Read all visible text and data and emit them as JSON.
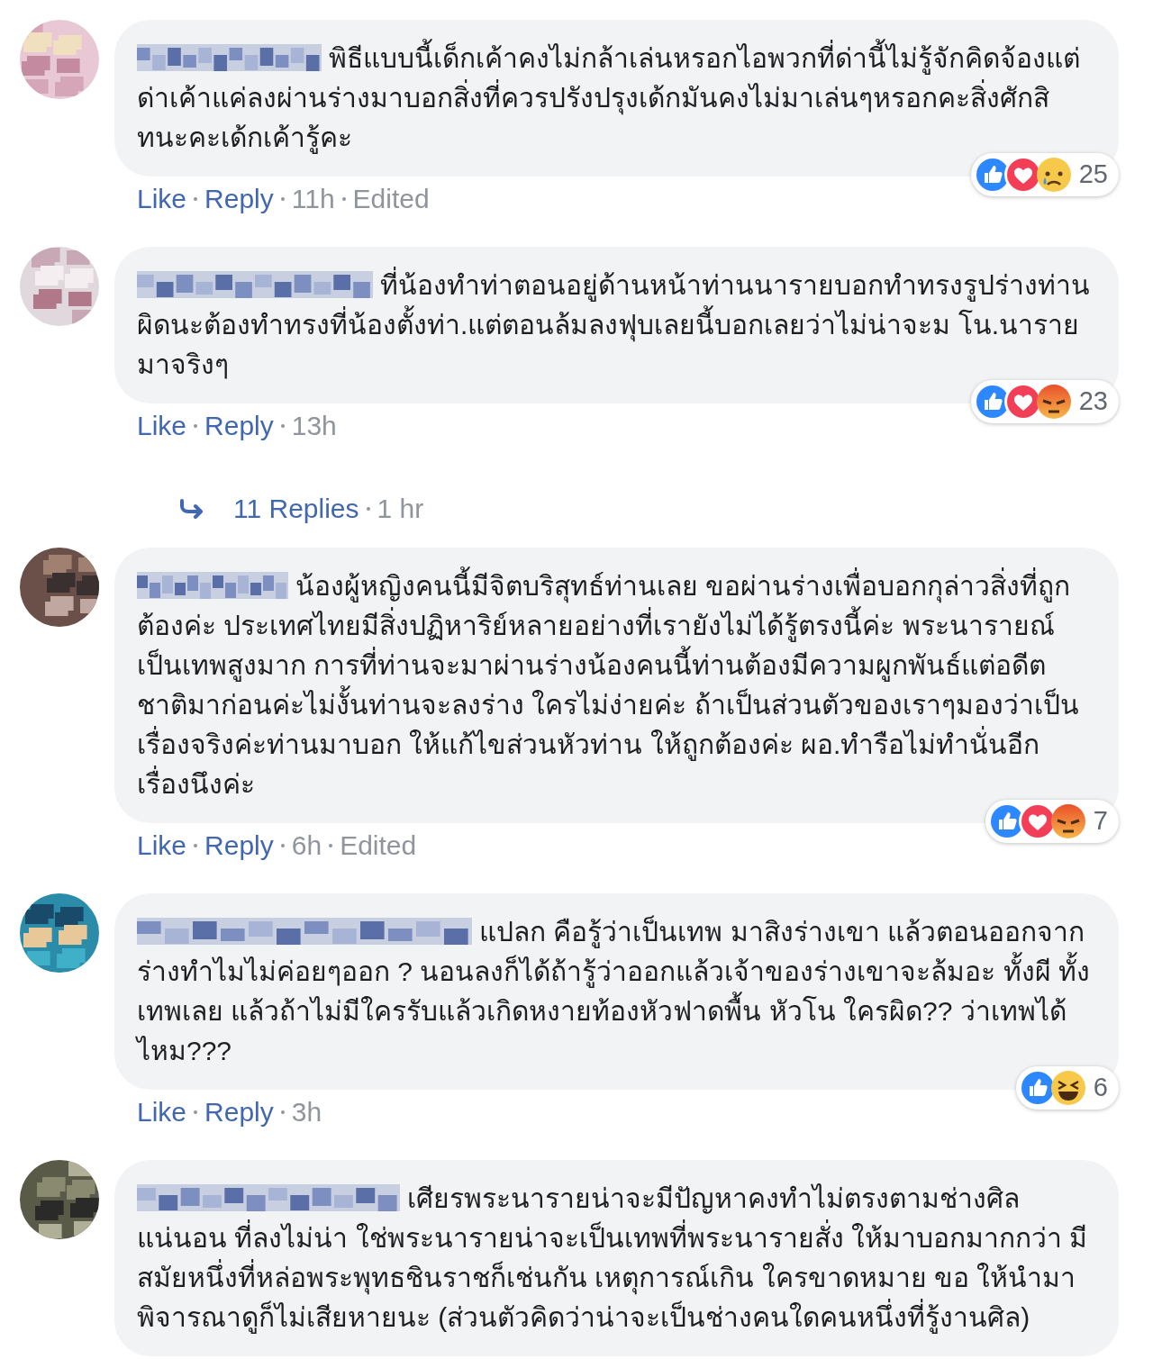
{
  "comments": [
    {
      "text": "พิธีแบบนี้เด็กเค้าคงไม่กล้าเล่นหรอกไอพวกที่ด่านี้ไม่รู้จักคิดจ้องแต่ด่าเค้าแค่ลงผ่านร่างมาบอกสิ่งที่ควรปรังปรุงเด้กมันคงไม่มาเล่นๆหรอกคะสิ่งศักสิทนะคะเด้กเค้ารู้คะ",
      "reactions": [
        {
          "kind": "like"
        },
        {
          "kind": "love"
        },
        {
          "kind": "sad"
        }
      ],
      "reaction_count": "25",
      "actions": [
        "Like",
        "Reply"
      ],
      "time": "11h",
      "edited": "Edited"
    },
    {
      "text": "ที่น้องทำท่าตอนอยู่ด้านหน้าท่านนารายบอกทำทรงรูปร่างท่านผิดนะต้องทำทรงที่น้องตั้งท่า.แต่ตอนล้มลงฟุบเลยนี้บอกเลยว่าไม่น่าจะม โน.นารายมาจริงๆ",
      "reactions": [
        {
          "kind": "like"
        },
        {
          "kind": "love"
        },
        {
          "kind": "angry"
        }
      ],
      "reaction_count": "23",
      "actions": [
        "Like",
        "Reply"
      ],
      "time": "13h",
      "replies": {
        "label": "11 Replies",
        "time": "1 hr"
      }
    },
    {
      "text": "น้องผู้หญิงคนนี้มีจิตบริสุทธ์ท่านเลย ขอผ่านร่างเพื่อบอกกุล่าวสิ่งที่ถูกต้องค่ะ ประเทศไทยมีสิ่งปฏิหาริย์หลายอย่างที่เรายังไม่ได้รู้ตรงนี้ค่ะ พระนารายณ์ เป็นเทพสูงมาก การที่ท่านจะมาผ่านร่างน้องคนนี้ท่านต้องมีความผูกพันธ์แต่อดีตชาติมาก่อนค่ะไม่งั้นท่านจะลงร่าง ใครไม่ง่ายค่ะ ถ้าเป็นส่วนตัวของเราๆมองว่าเป็นเรื่องจริงค่ะท่านมาบอก ให้แก้ไขส่วนหัวท่าน ให้ถูกต้องค่ะ ผอ.ทำรือไม่ทำนั่นอีกเรื่องนึงค่ะ",
      "reactions": [
        {
          "kind": "like"
        },
        {
          "kind": "love"
        },
        {
          "kind": "angry"
        }
      ],
      "reaction_count": "7",
      "actions": [
        "Like",
        "Reply"
      ],
      "time": "6h",
      "edited": "Edited"
    },
    {
      "text": "แปลก คือรู้ว่าเป็นเทพ มาสิงร่างเขา แล้วตอนออกจากร่างทำไมไม่ค่อยๆออก ? นอนลงก็ได้ถ้ารู้ว่าออกแล้วเจ้าของร่างเขาจะล้มอะ ทั้งผี ทั้งเทพเลย แล้วถ้าไม่มีใครรับแล้วเกิดหงายท้องหัวฟาดพื้น หัวโน ใครผิด?? ว่าเทพได้ไหม???",
      "reactions": [
        {
          "kind": "like"
        },
        {
          "kind": "haha"
        }
      ],
      "reaction_count": "6",
      "actions": [
        "Like",
        "Reply"
      ],
      "time": "3h"
    },
    {
      "text": "เศียรพระนารายน่าจะมีปัญหาคงทำไม่ตรงตามช่างศิลแน่นอน ที่ลงไม่น่า ใช่พระนารายน่าจะเป็นเทพที่พระนารายสั่ง ให้มาบอกมากกว่า มีสมัยหนึ่งที่หล่อพระพุทธชินราชก็เช่นกัน เหตุการณ์เกิน ใครขาดหมาย ขอ ให้นำมาพิจารณาดูก็ไม่เสียหายนะ (ส่วนตัวคิดว่าน่าจะเป็นช่างคนใดคนหนึ่งที่รู้งานศิล)"
    }
  ]
}
